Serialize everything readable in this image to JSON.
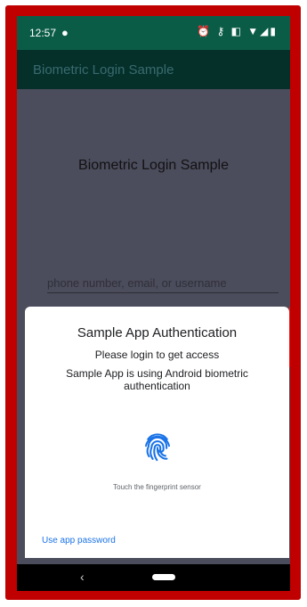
{
  "status_bar": {
    "time": "12:57",
    "notification_icon": "chat-bubble-icon",
    "icons": "⏰ ⚷ ◧ ▼◢▮"
  },
  "app_bar": {
    "title": "Biometric Login Sample"
  },
  "content": {
    "title": "Biometric Login Sample",
    "username_placeholder": "phone number, email, or username"
  },
  "biometric_dialog": {
    "title": "Sample App Authentication",
    "subtitle": "Please login to get access",
    "description": "Sample App is using Android biometric authentication",
    "icon": "fingerprint-icon",
    "hint": "Touch the fingerprint sensor",
    "negative_button": "Use app password",
    "accent_color": "#1a73e8",
    "icon_color": "#1a73e8"
  },
  "nav_bar": {
    "back_glyph": "‹"
  },
  "colors": {
    "frame": "#c00000",
    "status_bar": "#0b5c47",
    "app_bar": "#05302a",
    "scrim_content": "#4b4c5c"
  }
}
